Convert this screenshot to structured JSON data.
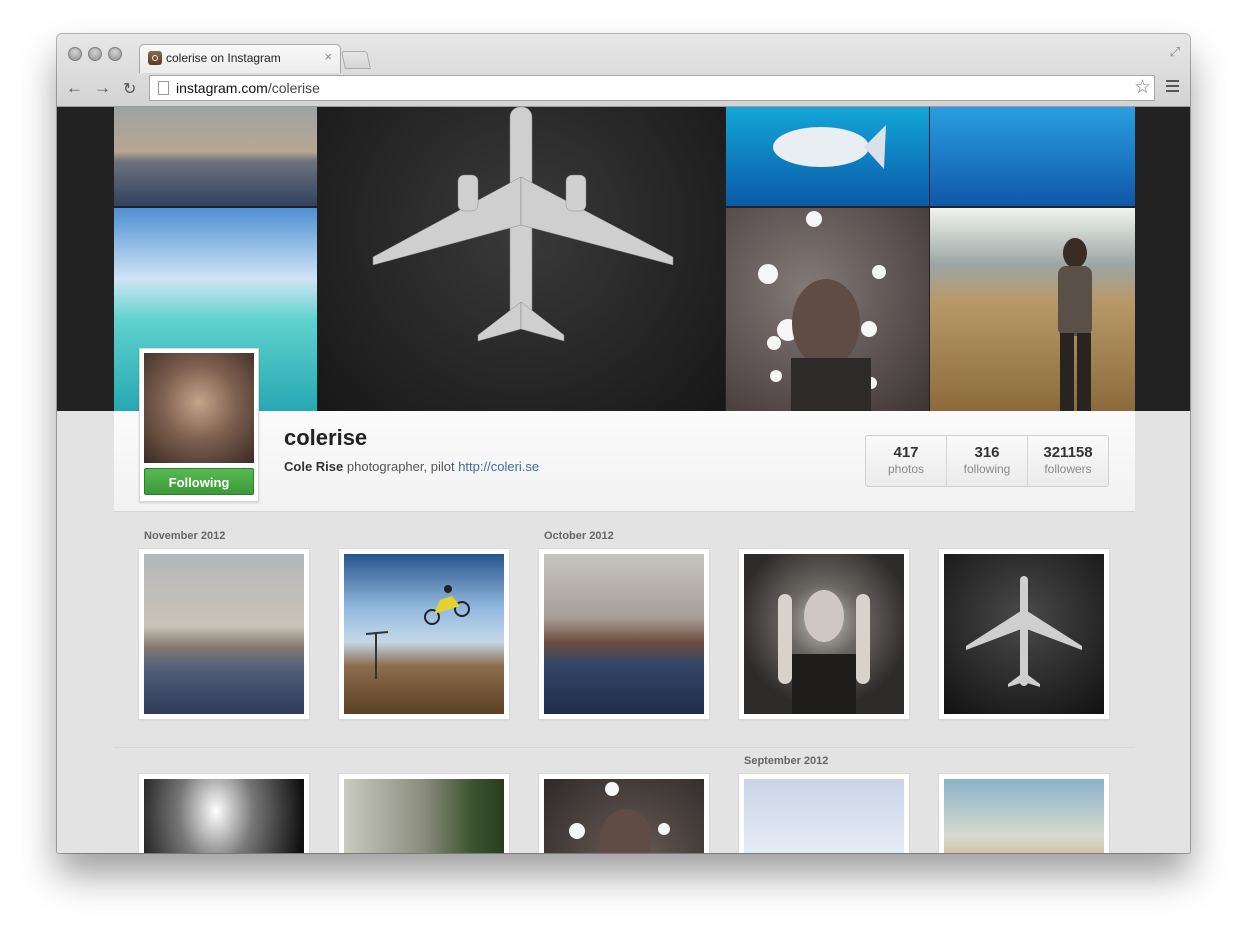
{
  "browser": {
    "tab_title": "colerise on Instagram",
    "tab_close": "×",
    "url_host": "instagram.com",
    "url_path": "/colerise",
    "back": "←",
    "forward": "→",
    "reload": "↻",
    "star": "☆",
    "maximize": "⤢"
  },
  "profile": {
    "username": "colerise",
    "full_name": "Cole Rise",
    "bio": "photographer, pilot",
    "website": "http://coleri.se",
    "follow_button": "Following",
    "stats": [
      {
        "value": "417",
        "label": "photos"
      },
      {
        "value": "316",
        "label": "following"
      },
      {
        "value": "321158",
        "label": "followers"
      }
    ]
  },
  "feed": {
    "months": [
      "November 2012",
      "October 2012",
      "September 2012"
    ]
  },
  "colors": {
    "follow_green": "#3b9a37",
    "link_blue": "#3d6d9c"
  }
}
